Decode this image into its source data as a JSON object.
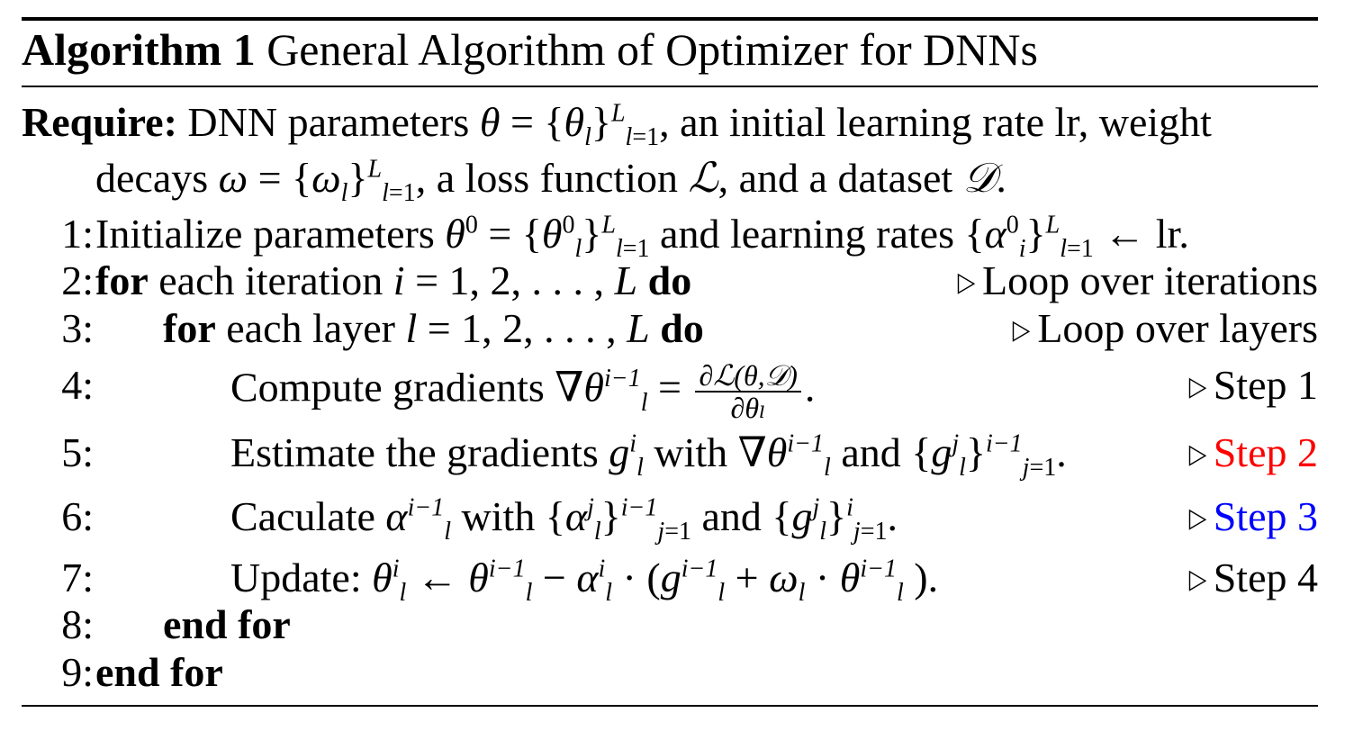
{
  "caption": {
    "label": "Algorithm 1",
    "title": "General Algorithm of Optimizer for DNNs"
  },
  "require": {
    "keyword": "Require:",
    "line1": "DNN parameters θ = {θₗ}ᴸₗ₌₁, an initial learning rate lr, weight",
    "line2": "decays ω = {ωₗ}ᴸₗ₌₁, a loss function ℒ, and a dataset 𝒟."
  },
  "steps": [
    {
      "num": "1:",
      "text": "Initialize parameters θ⁰ = {θₗ⁰}ᴸₗ₌₁ and learning rates {αᵢ⁰}ᴸₗ₌₁ ← lr.",
      "comment": ""
    },
    {
      "num": "2:",
      "kw": "for",
      "text": "each iteration i = 1, 2, . . . , L",
      "kw_end": "do",
      "comment": "Loop over iterations"
    },
    {
      "num": "3:",
      "kw": "for",
      "text": "each layer l = 1, 2, . . . , L",
      "kw_end": "do",
      "comment": "Loop over layers"
    },
    {
      "num": "4:",
      "text": "Compute gradients ∇θₗⁱ⁻¹ =",
      "frac_num": "∂ℒ(θ,𝒟)",
      "frac_den": "∂θₗ",
      "text_end": ".",
      "comment": "Step 1",
      "comment_color": "#000000"
    },
    {
      "num": "5:",
      "text": "Estimate the gradients gₗⁱ with ∇θₗⁱ⁻¹ and {gₗʲ}ⁱ⁻¹ⱼ₌₁.",
      "comment": "Step 2",
      "comment_color": "#ff0000"
    },
    {
      "num": "6:",
      "text": "Caculate αₗⁱ⁻¹ with {αₗʲ}ⁱ⁻¹ⱼ₌₁ and {gₗʲ}ⁱⱼ₌₁.",
      "comment": "Step 3",
      "comment_color": "#0000ff"
    },
    {
      "num": "7:",
      "text": "Update: θₗⁱ ← θₗⁱ⁻¹ − αₗⁱ · (gₗⁱ⁻¹ + ωₗ · θₗⁱ⁻¹ ).",
      "comment": "Step 4",
      "comment_color": "#000000"
    },
    {
      "num": "8:",
      "kw": "end for",
      "comment": ""
    },
    {
      "num": "9:",
      "kw": "end for",
      "comment": ""
    }
  ],
  "comment_marker": "▷"
}
